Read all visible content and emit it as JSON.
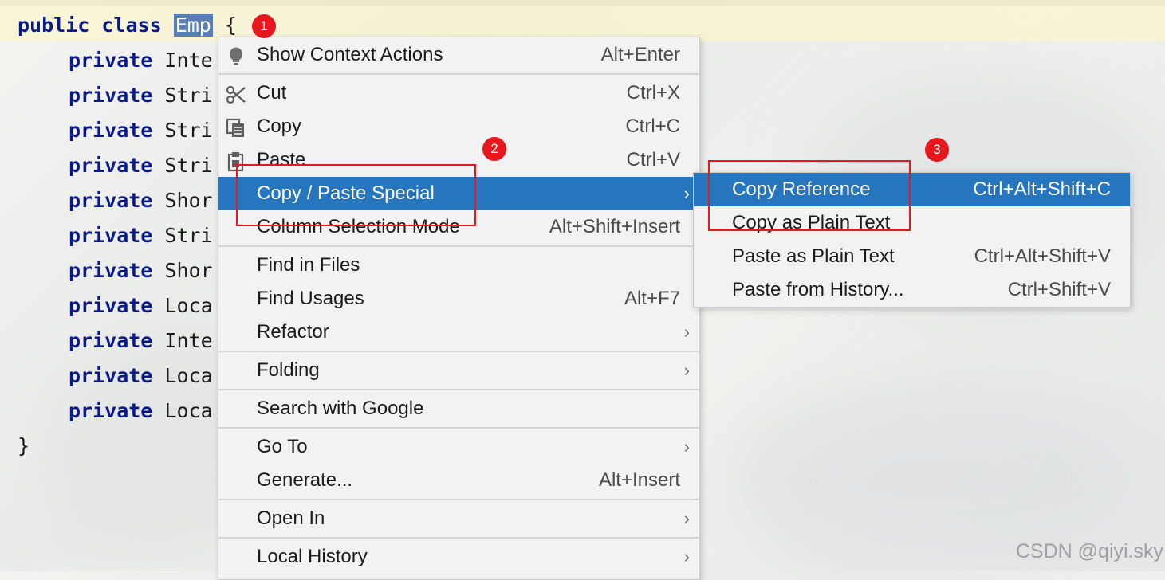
{
  "editor": {
    "class_line": {
      "kw": "public class",
      "name": "Emp",
      "brace": "{"
    },
    "fields": [
      {
        "kw": "private",
        "type": "Inte"
      },
      {
        "kw": "private",
        "type": "Stri"
      },
      {
        "kw": "private",
        "type": "Stri"
      },
      {
        "kw": "private",
        "type": "Stri"
      },
      {
        "kw": "private",
        "type": "Shor"
      },
      {
        "kw": "private",
        "type": "Stri"
      },
      {
        "kw": "private",
        "type": "Shor"
      },
      {
        "kw": "private",
        "type": "Loca"
      },
      {
        "kw": "private",
        "type": "Inte"
      },
      {
        "kw": "private",
        "type": "Loca"
      },
      {
        "kw": "private",
        "type": "Loca"
      }
    ],
    "closing_brace": "}"
  },
  "badges": [
    "1",
    "2",
    "3"
  ],
  "context_menu": {
    "items": [
      {
        "label": "Show Context Actions",
        "shortcut": "Alt+Enter"
      },
      {
        "label": "Cut",
        "shortcut": "Ctrl+X"
      },
      {
        "label": "Copy",
        "shortcut": "Ctrl+C"
      },
      {
        "label": "Paste",
        "shortcut": "Ctrl+V"
      },
      {
        "label": "Copy / Paste Special",
        "shortcut": ""
      },
      {
        "label": "Column Selection Mode",
        "shortcut": "Alt+Shift+Insert"
      },
      {
        "label": "Find in Files",
        "shortcut": ""
      },
      {
        "label": "Find Usages",
        "shortcut": "Alt+F7"
      },
      {
        "label": "Refactor",
        "shortcut": ""
      },
      {
        "label": "Folding",
        "shortcut": ""
      },
      {
        "label": "Search with Google",
        "shortcut": ""
      },
      {
        "label": "Go To",
        "shortcut": ""
      },
      {
        "label": "Generate...",
        "shortcut": "Alt+Insert"
      },
      {
        "label": "Open In",
        "shortcut": ""
      },
      {
        "label": "Local History",
        "shortcut": ""
      }
    ]
  },
  "submenu": {
    "items": [
      {
        "label": "Copy Reference",
        "shortcut": "Ctrl+Alt+Shift+C"
      },
      {
        "label": "Copy as Plain Text",
        "shortcut": ""
      },
      {
        "label": "Paste as Plain Text",
        "shortcut": "Ctrl+Alt+Shift+V"
      },
      {
        "label": "Paste from History...",
        "shortcut": "Ctrl+Shift+V"
      }
    ]
  },
  "watermark": "CSDN @qiyi.sky",
  "colors": {
    "highlight": "#2675bf",
    "annotation": "#e8161d",
    "keyword": "#0a1a8a",
    "selection": "#5a7eb6"
  },
  "icons": [
    "lightbulb-icon",
    "scissors-icon",
    "copy-icon",
    "clipboard-icon",
    "chevron-right-icon"
  ]
}
